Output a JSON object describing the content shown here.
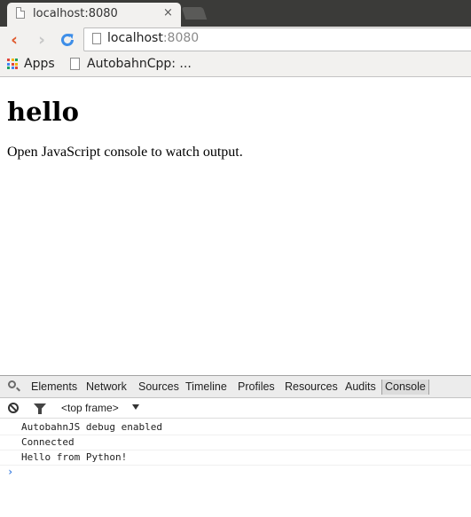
{
  "browser": {
    "tab_title": "localhost:8080",
    "tab_close": "×",
    "nav": {
      "back": "‹",
      "forward": "›",
      "reload": "C"
    },
    "address": {
      "host": "localhost",
      "port": ":8080"
    }
  },
  "bookmarks": {
    "apps_label": "Apps",
    "items": [
      {
        "label": "AutobahnCpp: ..."
      }
    ],
    "apps_colors": [
      "#e0453a",
      "#f4b400",
      "#1aa260",
      "#4285f4",
      "#e0453a",
      "#f4b400",
      "#1aa260",
      "#4285f4",
      "#e0453a"
    ]
  },
  "page": {
    "heading": "hello",
    "paragraph": "Open JavaScript console to watch output."
  },
  "devtools": {
    "tabs": [
      "Elements",
      "Network",
      "Sources",
      "Timeline",
      "Profiles",
      "Resources",
      "Audits",
      "Console"
    ],
    "active_tab": "Console",
    "frame_selector": "<top frame>",
    "console_lines": [
      "AutobahnJS debug enabled",
      "Connected",
      "Hello from Python!"
    ],
    "prompt": "›"
  }
}
